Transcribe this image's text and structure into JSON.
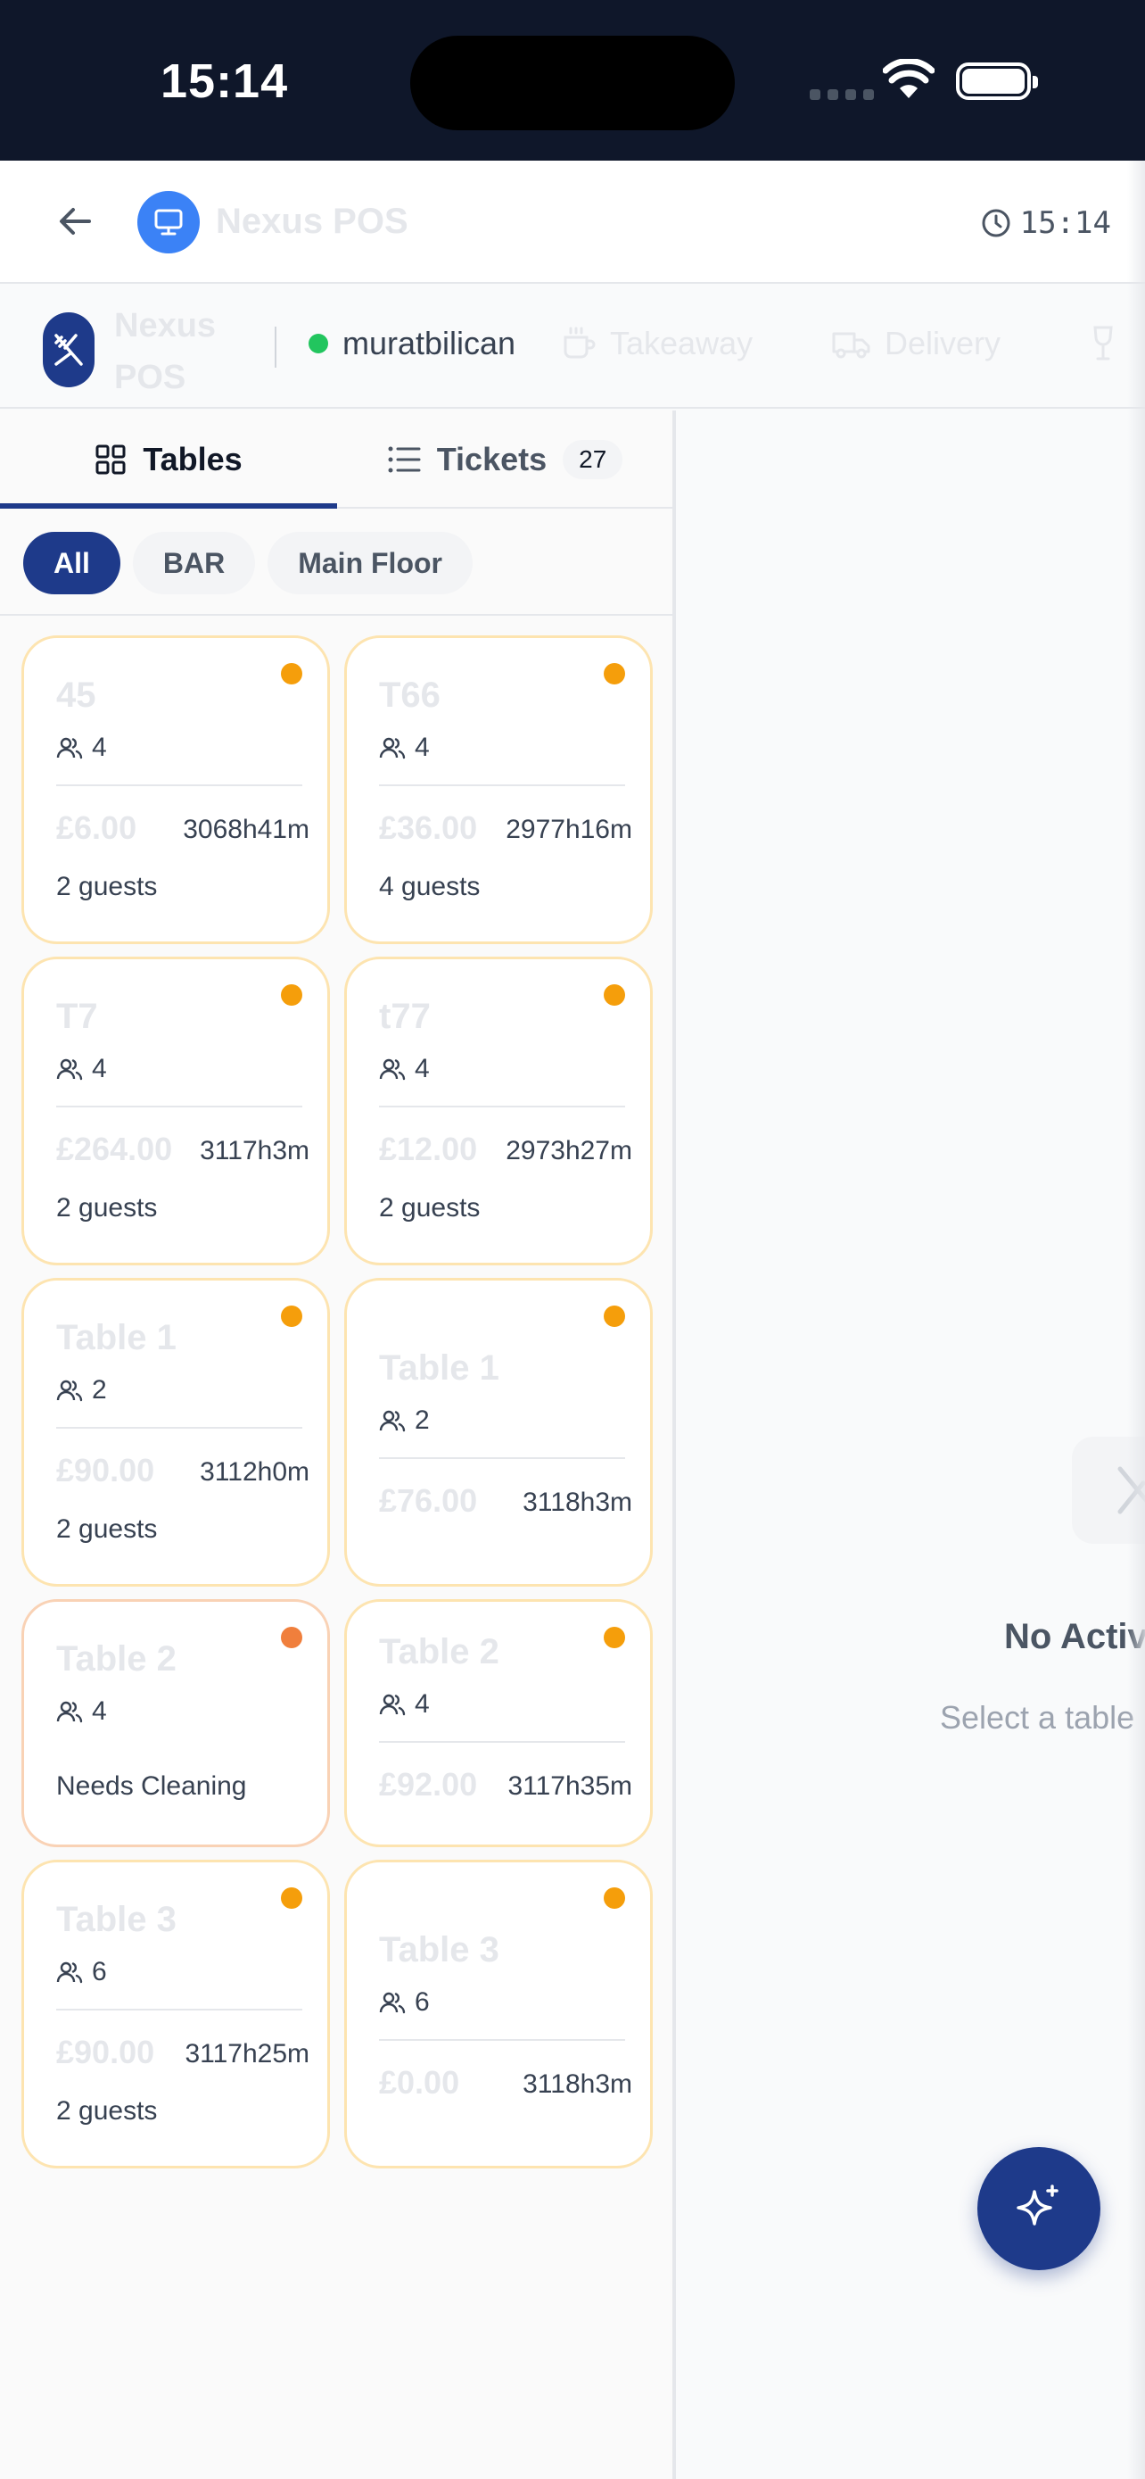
{
  "status_bar": {
    "time": "15:14"
  },
  "app_bar": {
    "title": "Nexus POS",
    "time": "15:14"
  },
  "venue_bar": {
    "name": "Nexus POS",
    "user": "muratbilican",
    "modes": [
      {
        "label": "Takeaway",
        "icon": "coffee-cup-icon"
      },
      {
        "label": "Delivery",
        "icon": "truck-icon"
      },
      {
        "label": "",
        "icon": "wine-glass-icon"
      }
    ]
  },
  "tabs": [
    {
      "label": "Tables",
      "icon": "grid-icon",
      "active": true
    },
    {
      "label": "Tickets",
      "icon": "list-icon",
      "count": "27"
    }
  ],
  "filters": [
    {
      "label": "All",
      "active": true
    },
    {
      "label": "BAR"
    },
    {
      "label": "Main Floor"
    }
  ],
  "tables": [
    {
      "name": "45",
      "seats": "4",
      "price": "£6.00",
      "duration": "3068h41m",
      "guests": "2 guests",
      "status": "occupied"
    },
    {
      "name": "T66",
      "seats": "4",
      "price": "£36.00",
      "duration": "2977h16m",
      "guests": "4 guests",
      "status": "occupied"
    },
    {
      "name": "T7",
      "seats": "4",
      "price": "£264.00",
      "duration": "3117h3m",
      "guests": "2 guests",
      "status": "occupied"
    },
    {
      "name": "t77",
      "seats": "4",
      "price": "£12.00",
      "duration": "2973h27m",
      "guests": "2 guests",
      "status": "occupied"
    },
    {
      "name": "Table 1",
      "seats": "2",
      "price": "£90.00",
      "duration": "3112h0m",
      "guests": "2 guests",
      "status": "occupied"
    },
    {
      "name": "Table 1",
      "seats": "2",
      "price": "£76.00",
      "duration": "3118h3m",
      "guests": "",
      "status": "occupied"
    },
    {
      "name": "Table 2",
      "seats": "4",
      "note": "Needs Cleaning",
      "status": "cleaning"
    },
    {
      "name": "Table 2",
      "seats": "4",
      "price": "£92.00",
      "duration": "3117h35m",
      "status": "occupied"
    },
    {
      "name": "Table 3",
      "seats": "6",
      "price": "£90.00",
      "duration": "3117h25m",
      "guests": "2 guests",
      "status": "occupied"
    },
    {
      "name": "Table 3",
      "seats": "6",
      "price": "£0.00",
      "duration": "3118h3m",
      "guests": "",
      "status": "occupied"
    }
  ],
  "detail_panel": {
    "empty_title": "No Activ",
    "empty_subtitle": "Select a table"
  },
  "fab": {
    "icon": "sparkles-icon"
  },
  "colors": {
    "primary": "#1e3a8a",
    "accent_blue": "#3b82f6",
    "online": "#22c55e",
    "occupied": "#f59e0b",
    "cleaning": "#f07f3c"
  }
}
